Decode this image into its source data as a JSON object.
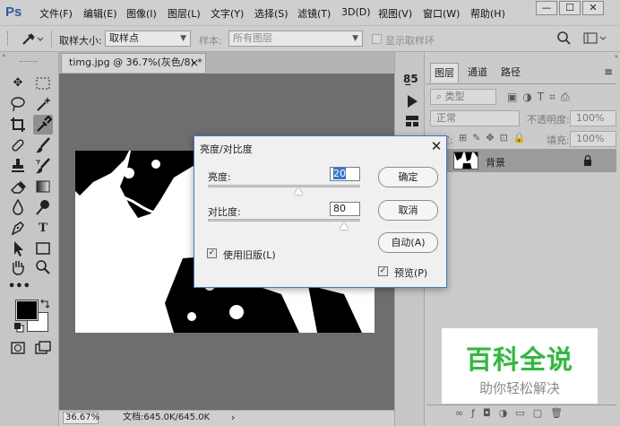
{
  "app": {
    "logo": "Ps"
  },
  "menu": [
    "文件(F)",
    "编辑(E)",
    "图像(I)",
    "图层(L)",
    "文字(Y)",
    "选择(S)",
    "滤镜(T)",
    "3D(D)",
    "视图(V)",
    "窗口(W)",
    "帮助(H)"
  ],
  "window_buttons": [
    "—",
    "☐",
    "✕"
  ],
  "options": {
    "sample_size_label": "取样大小:",
    "sample_size_value": "取样点",
    "sample_label": "样本:",
    "sample_value": "所有图层",
    "show_ring_label": "显示取样环"
  },
  "document": {
    "tab_title": "timg.jpg @ 36.7%(灰色/8) *",
    "tab_close": "×",
    "zoom": "36.67%",
    "doc_info": "文档:645.0K/645.0K",
    "status_arrow": "›"
  },
  "panel": {
    "tabs": [
      "图层",
      "通道",
      "路径"
    ],
    "filter_kind": "类型",
    "blend_mode": "正常",
    "opacity_label": "不透明度:",
    "opacity_value": "100%",
    "lock_label": "锁定:",
    "fill_label": "填充:",
    "fill_value": "100%",
    "layer_name": "背景"
  },
  "dialog": {
    "title": "亮度/对比度",
    "close": "✕",
    "brightness_label": "亮度:",
    "brightness_value": "20",
    "contrast_label": "对比度:",
    "contrast_value": "80",
    "use_legacy_label": "使用旧版(L)",
    "use_legacy_checked": true,
    "ok_label": "确定",
    "cancel_label": "取消",
    "auto_label": "自动(A)",
    "preview_label": "预览(P)",
    "preview_checked": true
  },
  "watermark": {
    "title": "百科全说",
    "subtitle": "助你轻松解决"
  },
  "colors": {
    "dialog_border": "#3a7bd5",
    "selection": "#3478d4",
    "watermark_green": "#2dbb3a"
  }
}
